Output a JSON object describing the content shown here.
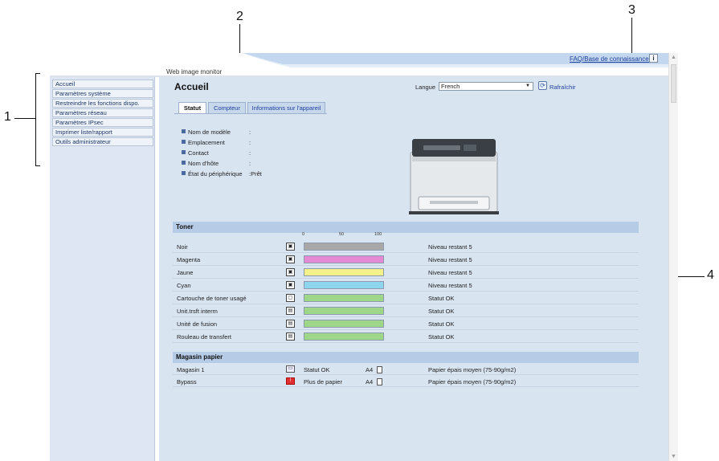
{
  "callouts": [
    "1",
    "2",
    "3",
    "4"
  ],
  "banner": {
    "title": "Web image monitor",
    "faq_link": "FAQ/Base de connaissances",
    "info_icon": "i"
  },
  "sidebar": {
    "items": [
      {
        "label": "Accueil"
      },
      {
        "label": "Paramètres système"
      },
      {
        "label": "Restreindre les fonctions dispo."
      },
      {
        "label": "Paramètres réseau"
      },
      {
        "label": "Paramètres IPsec"
      },
      {
        "label": "Imprimer liste/rapport"
      },
      {
        "label": "Outils administrateur"
      }
    ]
  },
  "main": {
    "title": "Accueil",
    "language_label": "Langue",
    "language_value": "French",
    "refresh_label": "Rafraîchir",
    "tabs": [
      {
        "label": "Statut",
        "active": true
      },
      {
        "label": "Compteur",
        "active": false
      },
      {
        "label": "Informations sur l'appareil",
        "active": false
      }
    ],
    "info": [
      {
        "label": "Nom de modèle",
        "value": ""
      },
      {
        "label": "Emplacement",
        "value": ""
      },
      {
        "label": "Contact",
        "value": ""
      },
      {
        "label": "Nom d'hôte",
        "value": ""
      },
      {
        "label": "État du périphérique",
        "value": "Prêt"
      }
    ]
  },
  "toner": {
    "header": "Toner",
    "scale": [
      "0",
      "50",
      "100"
    ],
    "rows": [
      {
        "name": "Noir",
        "level": 100,
        "color": "#a8a8a8",
        "status": "Niveau restant 5"
      },
      {
        "name": "Magenta",
        "level": 100,
        "color": "#e48ad4",
        "status": "Niveau restant 5"
      },
      {
        "name": "Jaune",
        "level": 100,
        "color": "#f4f08a",
        "status": "Niveau restant 5"
      },
      {
        "name": "Cyan",
        "level": 100,
        "color": "#8dd6ee",
        "status": "Niveau restant 5"
      },
      {
        "name": "Cartouche de toner usagé",
        "level": 100,
        "color": "#9ed68a",
        "status": "Statut OK"
      },
      {
        "name": "Unit.trsft interm",
        "level": 100,
        "color": "#9ed68a",
        "status": "Statut OK"
      },
      {
        "name": "Unité de fusion",
        "level": 100,
        "color": "#9ed68a",
        "status": "Statut OK"
      },
      {
        "name": "Rouleau de transfert",
        "level": 100,
        "color": "#9ed68a",
        "status": "Statut OK"
      }
    ]
  },
  "paper": {
    "header": "Magasin papier",
    "rows": [
      {
        "name": "Magasin 1",
        "status": "Statut OK",
        "size": "A4",
        "type": "Papier épais moyen (75-90g/m2)",
        "error": false
      },
      {
        "name": "Bypass",
        "status": "Plus de papier",
        "size": "A4",
        "type": "Papier épais moyen (75-90g/m2)",
        "error": true
      }
    ]
  },
  "colors": {
    "sidebar_bg": "#dde6f2",
    "main_bg": "#d9e4f1",
    "section_header": "#b5cbe6",
    "link": "#1f3f9c",
    "error": "#e03030"
  }
}
